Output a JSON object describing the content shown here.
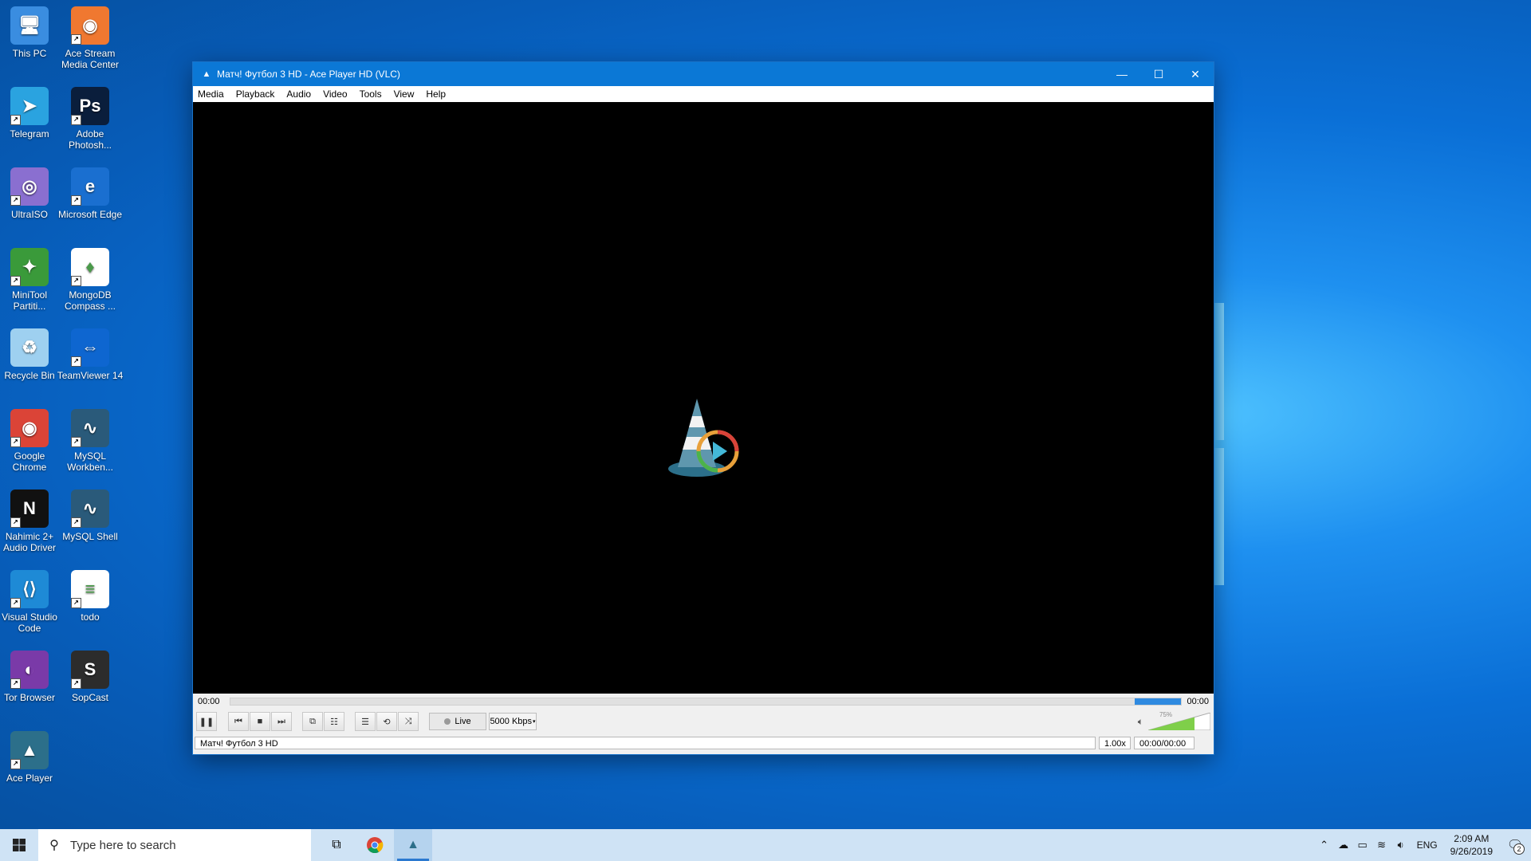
{
  "desktop": {
    "icons": [
      {
        "label": "This PC",
        "icon": "computer-icon"
      },
      {
        "label": "Ace Stream Media Center",
        "icon": "ace-stream-icon"
      },
      {
        "label": "Telegram",
        "icon": "telegram-icon"
      },
      {
        "label": "Adobe Photosh...",
        "icon": "photoshop-icon"
      },
      {
        "label": "UltraISO",
        "icon": "disc-icon"
      },
      {
        "label": "Microsoft Edge",
        "icon": "edge-icon"
      },
      {
        "label": "MiniTool Partiti...",
        "icon": "minitool-icon"
      },
      {
        "label": "MongoDB Compass ...",
        "icon": "mongodb-icon"
      },
      {
        "label": "Recycle Bin",
        "icon": "recycle-bin-icon"
      },
      {
        "label": "TeamViewer 14",
        "icon": "teamviewer-icon"
      },
      {
        "label": "Google Chrome",
        "icon": "chrome-icon"
      },
      {
        "label": "MySQL Workben...",
        "icon": "mysql-workbench-icon"
      },
      {
        "label": "Nahimic 2+ Audio Driver",
        "icon": "nahimic-icon"
      },
      {
        "label": "MySQL Shell",
        "icon": "mysql-shell-icon"
      },
      {
        "label": "Visual Studio Code",
        "icon": "vscode-icon"
      },
      {
        "label": "todo",
        "icon": "text-file-icon"
      },
      {
        "label": "Tor Browser",
        "icon": "tor-icon"
      },
      {
        "label": "SopCast",
        "icon": "sopcast-icon"
      },
      {
        "label": "Ace Player",
        "icon": "ace-player-icon"
      }
    ]
  },
  "window": {
    "title": "Матч! Футбол 3 HD - Ace Player HD (VLC)",
    "menu": [
      "Media",
      "Playback",
      "Audio",
      "Video",
      "Tools",
      "View",
      "Help"
    ],
    "seek": {
      "elapsed": "00:00",
      "total": "00:00"
    },
    "controls": {
      "live_label": "Live",
      "bitrate": "5000 Kbps",
      "volume_percent": "75%"
    },
    "status": {
      "stream_name": "Матч! Футбол 3 HD",
      "speed": "1.00x",
      "time": "00:00/00:00"
    }
  },
  "taskbar": {
    "search_placeholder": "Type here to search",
    "lang": "ENG",
    "time": "2:09 AM",
    "date": "9/26/2019",
    "notification_count": "2"
  },
  "colors": {
    "titlebar": "#0b78d6",
    "accent": "#2f8ae0"
  }
}
